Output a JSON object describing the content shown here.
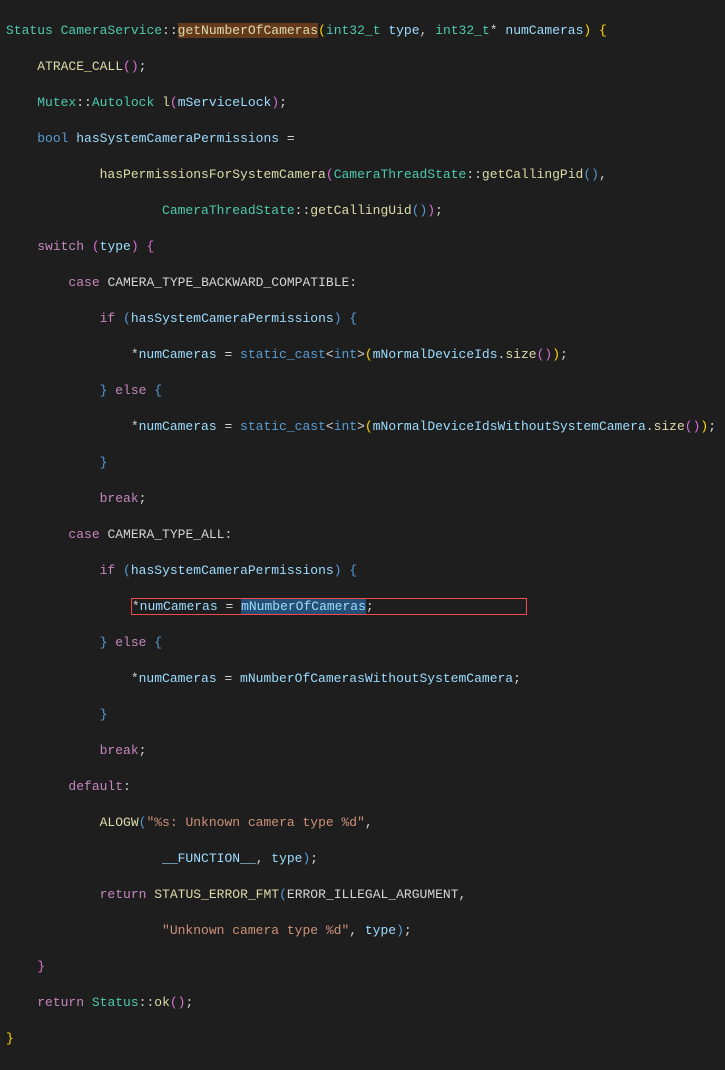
{
  "code": {
    "l1_a": "Status",
    "l1_b": "CameraService",
    "l1_fn": "getNumberOfCameras",
    "l1_c": "int32_t",
    "l1_d": "type",
    "l1_e": "int32_t",
    "l1_f": "numCameras",
    "l2": "ATRACE_CALL",
    "l3_a": "Mutex",
    "l3_b": "Autolock",
    "l3_c": "l",
    "l3_d": "mServiceLock",
    "l4_a": "bool",
    "l4_b": "hasSystemCameraPermissions",
    "l5_a": "hasPermissionsForSystemCamera",
    "l5_b": "CameraThreadState",
    "l5_c": "getCallingPid",
    "l6_a": "CameraThreadState",
    "l6_b": "getCallingUid",
    "l7_a": "switch",
    "l7_b": "type",
    "l8_a": "case",
    "l8_b": "CAMERA_TYPE_BACKWARD_COMPATIBLE",
    "l9_a": "if",
    "l9_b": "hasSystemCameraPermissions",
    "l10_a": "numCameras",
    "l10_b": "static_cast",
    "l10_c": "int",
    "l10_d": "mNormalDeviceIds",
    "l10_e": "size",
    "l11_a": "else",
    "l12_a": "numCameras",
    "l12_b": "static_cast",
    "l12_c": "int",
    "l12_d": "mNormalDeviceIdsWithoutSystemCamera",
    "l12_e": "size",
    "l14": "break",
    "l15_a": "case",
    "l15_b": "CAMERA_TYPE_ALL",
    "l16_a": "if",
    "l16_b": "hasSystemCameraPermissions",
    "l17_a": "numCameras",
    "l17_b": "mNumberOfCameras",
    "l18_a": "else",
    "l19_a": "numCameras",
    "l19_b": "mNumberOfCamerasWithoutSystemCamera",
    "l21": "break",
    "l22": "default",
    "l23_a": "ALOGW",
    "l23_b": "\"%s: Unknown camera type %d\"",
    "l24_a": "__FUNCTION__",
    "l24_b": "type",
    "l25_a": "return",
    "l25_b": "STATUS_ERROR_FMT",
    "l25_c": "ERROR_ILLEGAL_ARGUMENT",
    "l26_a": "\"Unknown camera type %d\"",
    "l26_b": "type",
    "l28_a": "return",
    "l28_b": "Status",
    "l28_c": "ok"
  }
}
